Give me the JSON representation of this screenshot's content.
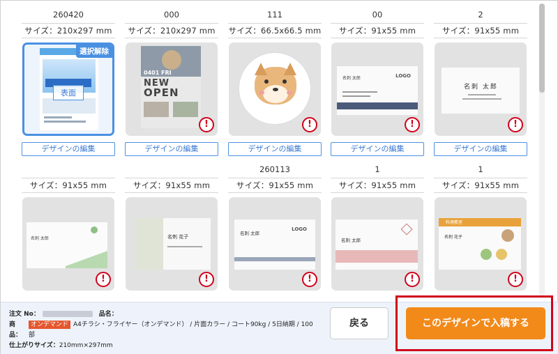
{
  "cards": [
    {
      "name": "260420",
      "size": "サイズ：210x297 mm",
      "edit_label": "デザインの編集",
      "selected": true,
      "badge": "選択解除",
      "side": "表面",
      "warn": false,
      "kind": "flyer-blue"
    },
    {
      "name": "000",
      "size": "サイズ：210x297 mm",
      "edit_label": "デザインの編集",
      "selected": false,
      "warn": true,
      "kind": "flyer-open",
      "thumb_text": [
        "0401 FRI",
        "NEW",
        "OPEN"
      ]
    },
    {
      "name": "111",
      "size": "サイズ：66.5x66.5 mm",
      "edit_label": "デザインの編集",
      "selected": false,
      "warn": true,
      "kind": "dog"
    },
    {
      "name": "00",
      "size": "サイズ：91x55 mm",
      "edit_label": "デザインの編集",
      "selected": false,
      "warn": true,
      "kind": "card-logo",
      "thumb_text": [
        "名刺 太郎",
        "LOGO"
      ]
    },
    {
      "name": "2",
      "size": "サイズ：91x55 mm",
      "edit_label": "デザインの編集",
      "selected": false,
      "warn": true,
      "kind": "card-plain",
      "thumb_text": [
        "名刺 太郎"
      ]
    },
    {
      "name": "",
      "size": "サイズ：91x55 mm",
      "selected": false,
      "warn": true,
      "kind": "card-green",
      "thumb_text": [
        "名刺 太郎"
      ]
    },
    {
      "name": "",
      "size": "サイズ：91x55 mm",
      "selected": false,
      "warn": true,
      "kind": "card-vert",
      "thumb_text": [
        "名刺 花子"
      ]
    },
    {
      "name": "260113",
      "size": "サイズ：91x55 mm",
      "selected": false,
      "warn": true,
      "kind": "card-logo2",
      "thumb_text": [
        "名刺 太郎",
        "LOGO"
      ]
    },
    {
      "name": "1",
      "size": "サイズ：91x55 mm",
      "selected": false,
      "warn": true,
      "kind": "card-red",
      "thumb_text": [
        "名刺 太郎"
      ]
    },
    {
      "name": "1",
      "size": "サイズ：91x55 mm",
      "selected": false,
      "warn": true,
      "kind": "card-food",
      "thumb_text": [
        "料理教室",
        "名刺 花子"
      ]
    }
  ],
  "bottom": {
    "order_label": "注文 No：",
    "product_label": "品名：",
    "product_label_col": [
      "商",
      "品："
    ],
    "ondemand_tag": "オンデマンド",
    "product_desc": "A4チラシ・フライヤー（オンデマンド） / 片面カラー / コート90kg / 5日納期 / 100",
    "unit": "部",
    "finish_label": "仕上がりサイズ：",
    "finish_value": "210mm×297mm",
    "back_label": "戻る",
    "submit_label": "このデザインで入稿する"
  },
  "colors": {
    "accent": "#4a90e2",
    "submit": "#f28a1a",
    "warn": "#d0021b",
    "tag": "#e4572e"
  }
}
